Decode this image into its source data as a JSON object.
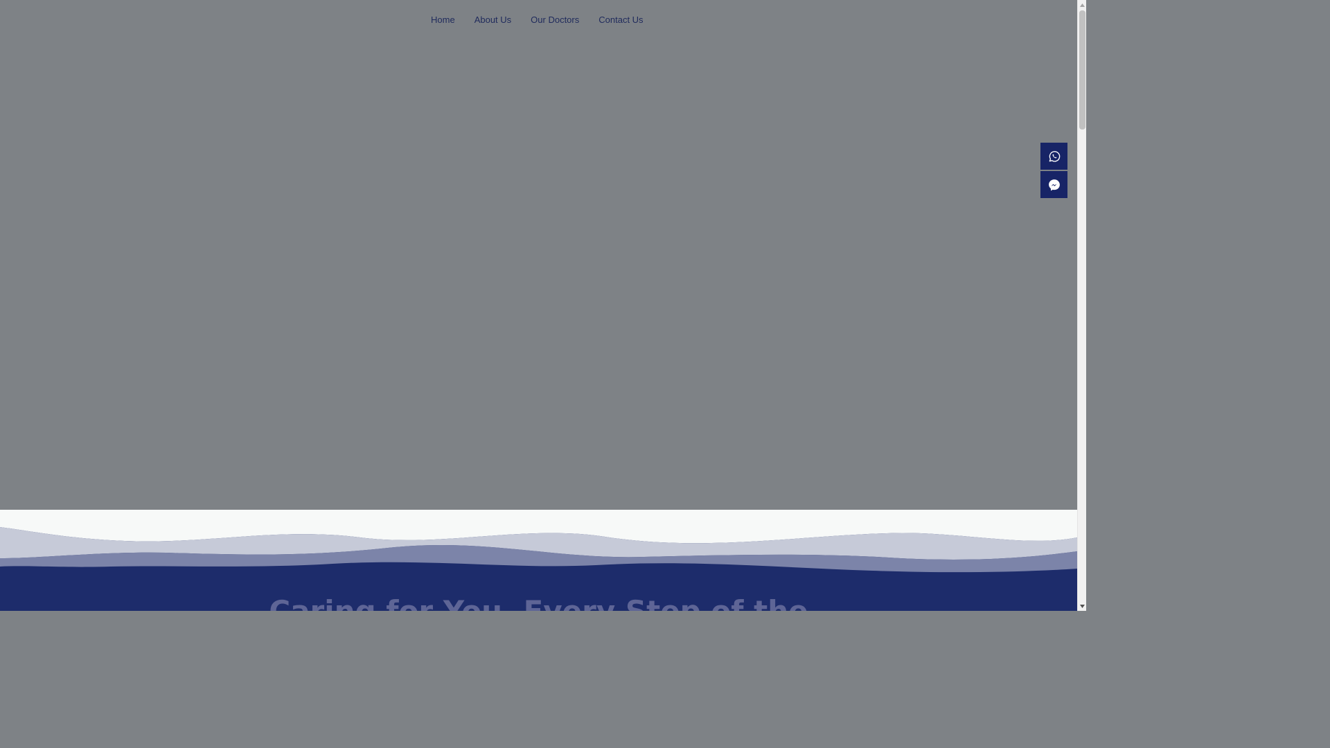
{
  "nav": {
    "items": [
      {
        "label": "Home"
      },
      {
        "label": "About Us"
      },
      {
        "label": "Our Doctors"
      },
      {
        "label": "Contact Us"
      }
    ]
  },
  "floating_buttons": [
    {
      "icon": "whatsapp-icon"
    },
    {
      "icon": "messenger-icon"
    }
  ],
  "hero": {
    "heading": "Caring for You, Every Step of the"
  },
  "colors": {
    "overlay": "#7e8286",
    "nav_text": "#1f2a5c",
    "button_bg": "#172466",
    "wave_dark": "#1d2c6b",
    "wave_light": "#c6cad8",
    "background_light": "#f7f9f8"
  }
}
